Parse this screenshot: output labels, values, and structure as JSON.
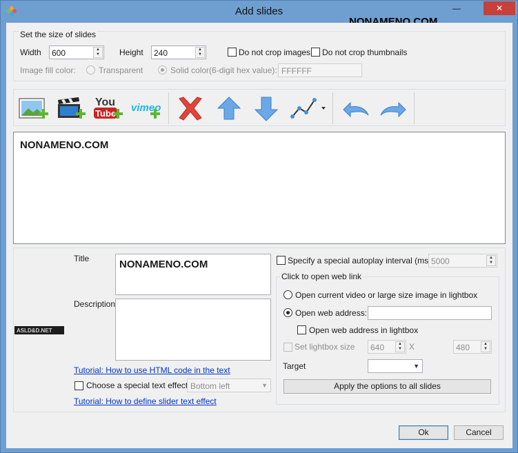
{
  "window": {
    "title": "Add slides",
    "watermark": "NONAMENO.COM",
    "minimize_glyph": "—",
    "close_glyph": "✕"
  },
  "size_group": {
    "legend": "Set the size of slides",
    "width_label": "Width",
    "width_value": "600",
    "height_label": "Height",
    "height_value": "240",
    "no_crop_images": "Do not crop images",
    "no_crop_thumbnails": "Do not crop thumbnails",
    "fill_color_label": "Image fill color:",
    "transparent_label": "Transparent",
    "solid_label": "Solid color(6-digit hex value):",
    "hex_value": "FFFFFF"
  },
  "toolbar": {
    "items": [
      {
        "name": "add-image",
        "icon": "image-add-icon"
      },
      {
        "name": "add-video",
        "icon": "video-add-icon"
      },
      {
        "name": "add-youtube",
        "icon": "youtube-add-icon"
      },
      {
        "name": "add-vimeo",
        "icon": "vimeo-add-icon"
      },
      {
        "name": "delete",
        "icon": "delete-icon"
      },
      {
        "name": "move-up",
        "icon": "arrow-up-icon"
      },
      {
        "name": "move-down",
        "icon": "arrow-down-icon"
      },
      {
        "name": "effects",
        "icon": "effects-icon"
      },
      {
        "name": "undo",
        "icon": "undo-icon"
      },
      {
        "name": "redo",
        "icon": "redo-icon"
      }
    ],
    "youtube_you": "You",
    "youtube_tube": "Tube",
    "vimeo_text": "vimeo"
  },
  "slide_list": {
    "watermark": "NONAMENO.COM"
  },
  "details": {
    "thumb_text": "ASLD&D.NET",
    "title_label": "Title",
    "title_value": "NONAMENO.COM",
    "description_label": "Description",
    "description_value": "",
    "tutorial_html_link": "Tutorial: How to use HTML code in the text",
    "special_effect_label": "Choose a special text effect",
    "effect_value": "Bottom left",
    "tutorial_effect_link": "Tutorial: How to define slider text effect",
    "autoplay_label": "Specify a special autoplay interval (ms):",
    "autoplay_value": "5000"
  },
  "web_link": {
    "legend": "Click to open web link",
    "open_lightbox_label": "Open current video or large size image in lightbox",
    "open_web_label": "Open web address:",
    "web_address_value": "",
    "web_in_lightbox_label": "Open web address in lightbox",
    "set_lightbox_size_label": "Set lightbox size",
    "lightbox_w": "640",
    "x_label": "X",
    "lightbox_h": "480",
    "target_label": "Target",
    "target_value": "",
    "apply_button": "Apply the options to all slides"
  },
  "footer": {
    "ok_button": "Ok",
    "cancel_button": "Cancel"
  },
  "colors": {
    "titlebar": "#6f9fd1",
    "close": "#c7403a",
    "link": "#0033cc",
    "client": "#f0f0f0"
  }
}
